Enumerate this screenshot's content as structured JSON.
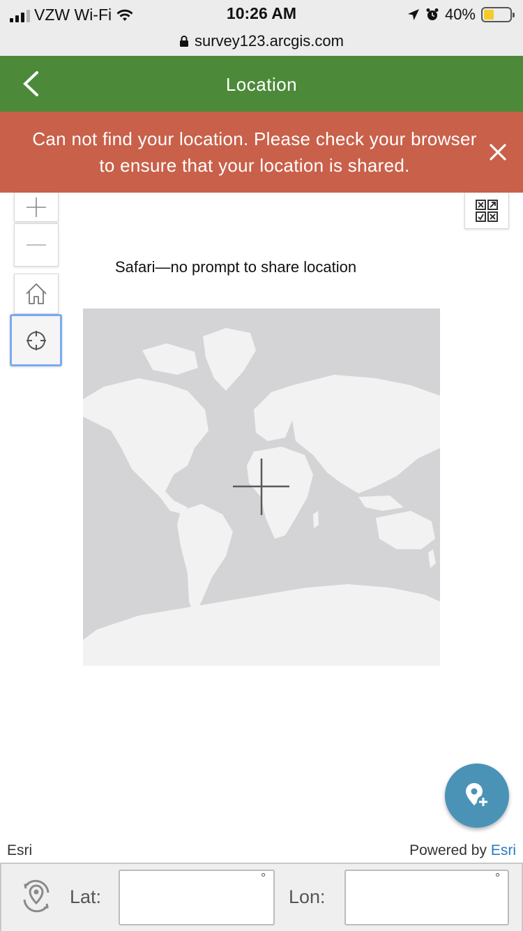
{
  "status_bar": {
    "carrier": "VZW Wi-Fi",
    "time": "10:26 AM",
    "battery": "40%",
    "battery_level": 0.4,
    "url": "survey123.arcgis.com",
    "icons": [
      "signal-icon",
      "wifi-icon",
      "location-arrow-icon",
      "alarm-icon",
      "battery-icon",
      "lock-icon"
    ]
  },
  "header": {
    "title": "Location",
    "back_icon": "chevron-left-icon",
    "color": "#4c8a3a"
  },
  "error_banner": {
    "message": "Can not find your location. Please check your browser to ensure that your location is shared.",
    "close_icon": "close-icon",
    "color": "#c9604a"
  },
  "map": {
    "controls": [
      "zoom-in-icon",
      "zoom-out-icon",
      "home-icon",
      "locate-icon",
      "qr-scan-icon"
    ],
    "caption": "Safari—no prompt to share location",
    "crosshair_icon": "crosshair-icon"
  },
  "fab": {
    "icon": "add-location-pin-icon",
    "color": "#4a93b7"
  },
  "attribution": {
    "left": "Esri",
    "powered_prefix": "Powered by ",
    "powered_link": "Esri"
  },
  "coordinates": {
    "icon": "location-refresh-icon",
    "lat_label": "Lat:",
    "lat_value": "",
    "lat_unit": "°",
    "lon_label": "Lon:",
    "lon_value": "",
    "lon_unit": "°"
  }
}
